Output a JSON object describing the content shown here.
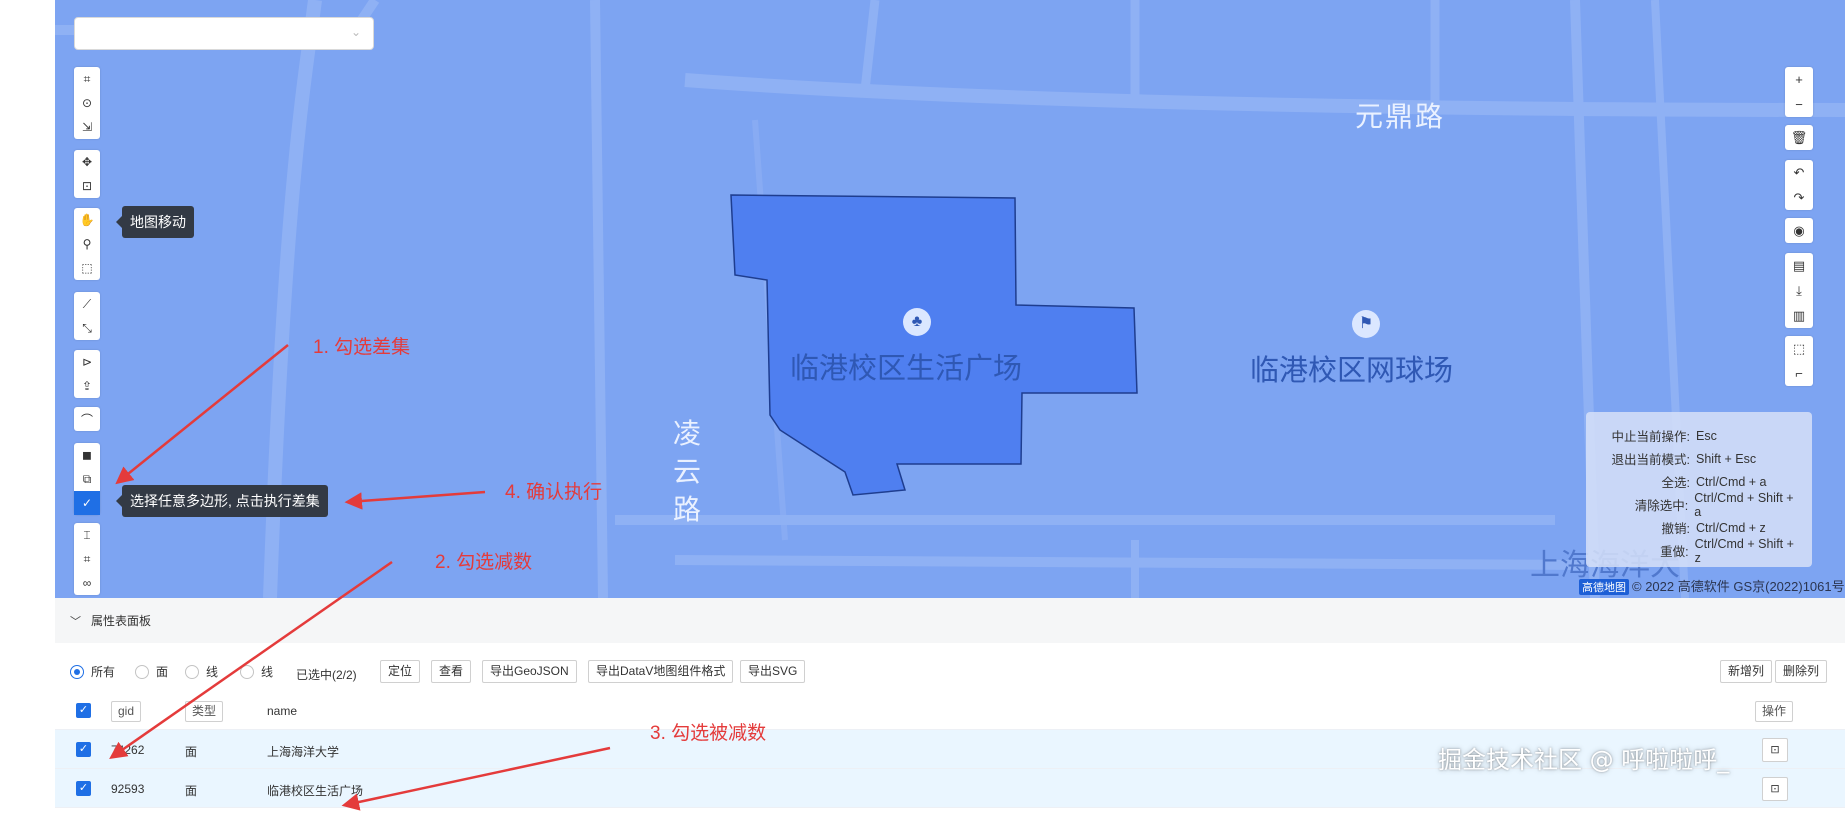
{
  "map": {
    "road_labels": [
      "元鼎路",
      "凌云路"
    ],
    "poi_labels": {
      "plaza": "临港校区生活广场",
      "tennis": "临港校区网球场",
      "university": "上海海洋大"
    },
    "colors": {
      "map_bg": "#7da4f2",
      "polygon_fill": "#4f7ff0",
      "polygon_stroke": "#1e3d8f"
    }
  },
  "tooltips": {
    "map_move": "地图移动",
    "difference": "选择任意多边形, 点击执行差集"
  },
  "left_tools": {
    "group1": [
      "rectangle-select-icon",
      "circle-select-icon",
      "path-select-icon"
    ],
    "group2": [
      "move-icon",
      "fit-view-icon"
    ],
    "group3": [
      "hand-pan-icon",
      "point-edit-icon",
      "rect-edit-icon"
    ],
    "group4": [
      "line-icon",
      "measure-icon"
    ],
    "group5": [
      "terminal-icon",
      "upload-icon"
    ],
    "group6": [
      "curve-icon"
    ],
    "group7": [
      "union-icon",
      "intersect-icon",
      "confirm-icon"
    ],
    "group8": [
      "split-icon",
      "crop-icon",
      "link-icon"
    ]
  },
  "right_tools": {
    "zoom": [
      "zoom-in-icon",
      "zoom-out-icon"
    ],
    "edit": [
      "delete-icon"
    ],
    "history": [
      "undo-icon",
      "redo-icon"
    ],
    "view": [
      "locate-icon"
    ],
    "file": [
      "file-icon",
      "download-icon",
      "export-file-icon"
    ],
    "select": [
      "box-select-icon",
      "lasso-icon"
    ]
  },
  "shortcuts": [
    {
      "label": "中止当前操作:",
      "key": "Esc"
    },
    {
      "label": "退出当前模式:",
      "key": "Shift + Esc"
    },
    {
      "label": "全选:",
      "key": "Ctrl/Cmd + a"
    },
    {
      "label": "清除选中:",
      "key": "Ctrl/Cmd + Shift + a"
    },
    {
      "label": "撤销:",
      "key": "Ctrl/Cmd + z"
    },
    {
      "label": "重做:",
      "key": "Ctrl/Cmd + Shift + z"
    }
  ],
  "attribution": {
    "logo": "高德地图",
    "text": "© 2022 高德软件 GS京(2022)1061号"
  },
  "annotations": {
    "step1": "1. 勾选差集",
    "step2": "2. 勾选减数",
    "step3": "3. 勾选被减数",
    "step4": "4. 确认执行",
    "color": "#e43b3b"
  },
  "panel": {
    "title": "属性表面板",
    "filters": [
      "所有",
      "面",
      "线",
      "线"
    ],
    "selected_filter": "所有",
    "selected_count": "已选中(2/2)",
    "buttons": [
      "定位",
      "查看",
      "导出GeoJSON",
      "导出DataV地图组件格式",
      "导出SVG"
    ],
    "right_buttons": [
      "新增列",
      "删除列"
    ],
    "columns": {
      "gid": "gid",
      "type": "类型",
      "name": "name",
      "action": "操作"
    },
    "rows": [
      {
        "gid": "74262",
        "type": "面",
        "name": "上海海洋大学"
      },
      {
        "gid": "92593",
        "type": "面",
        "name": "临港校区生活广场"
      }
    ]
  },
  "watermark": "掘金技术社区 @ 呼啦啦呼_"
}
